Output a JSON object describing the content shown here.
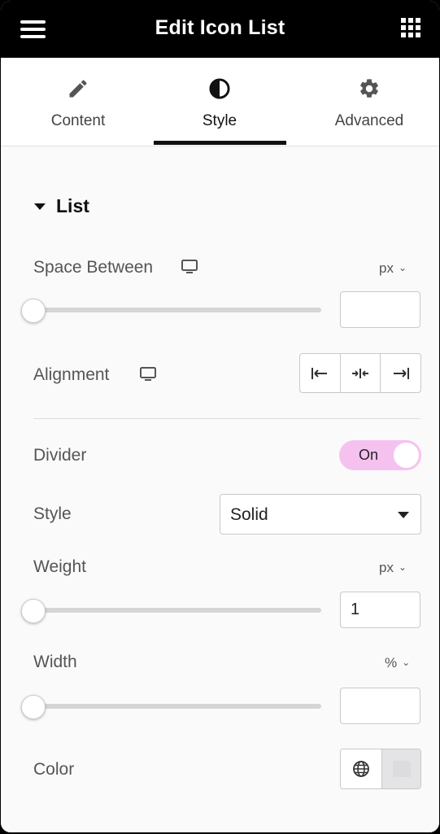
{
  "header": {
    "title": "Edit Icon List"
  },
  "tabs": [
    {
      "label": "Content",
      "icon": "pencil-icon",
      "active": false
    },
    {
      "label": "Style",
      "icon": "half-circle-icon",
      "active": true
    },
    {
      "label": "Advanced",
      "icon": "gear-icon",
      "active": false
    }
  ],
  "section": {
    "title": "List"
  },
  "space_between": {
    "label": "Space Between",
    "unit": "px",
    "value": ""
  },
  "alignment": {
    "label": "Alignment",
    "options": [
      "align-left",
      "align-center",
      "align-right"
    ]
  },
  "divider": {
    "label": "Divider",
    "toggle": "On"
  },
  "style": {
    "label": "Style",
    "value": "Solid"
  },
  "weight": {
    "label": "Weight",
    "unit": "px",
    "value": "1"
  },
  "width": {
    "label": "Width",
    "unit": "%",
    "value": ""
  },
  "color": {
    "label": "Color",
    "swatch": "#dcdcde"
  },
  "colors": {
    "toggle_on": "#f5c2f0",
    "header_bg": "#000000"
  }
}
